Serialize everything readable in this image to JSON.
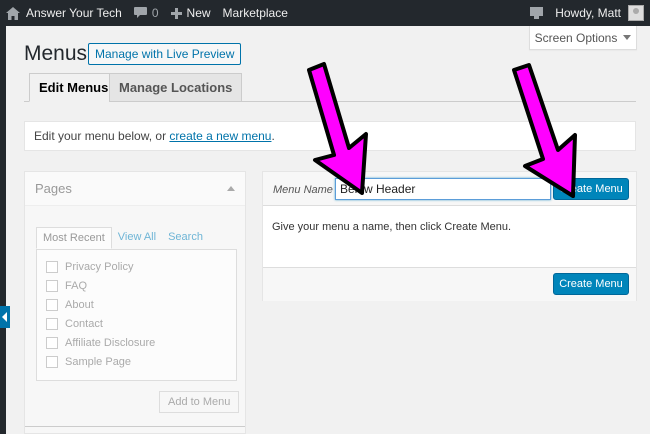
{
  "adminbar": {
    "site_name": "Answer Your Tech",
    "comments_count": "0",
    "new_label": "New",
    "marketplace_label": "Marketplace",
    "greeting": "Howdy, Matt"
  },
  "screen_options": {
    "label": "Screen Options"
  },
  "page": {
    "title": "Menus",
    "live_preview_label": "Manage with Live Preview"
  },
  "tabs": [
    {
      "label": "Edit Menus"
    },
    {
      "label": "Manage Locations"
    }
  ],
  "notice": {
    "prefix": "Edit your menu below, or ",
    "link": "create a new menu",
    "suffix": "."
  },
  "pages_panel": {
    "title": "Pages",
    "tabs": [
      {
        "label": "Most Recent"
      },
      {
        "label": "View All"
      },
      {
        "label": "Search"
      }
    ],
    "items": [
      {
        "label": "Privacy Policy"
      },
      {
        "label": "FAQ"
      },
      {
        "label": "About"
      },
      {
        "label": "Contact"
      },
      {
        "label": "Affiliate Disclosure"
      },
      {
        "label": "Sample Page"
      }
    ],
    "add_label": "Add to Menu"
  },
  "menu_editor": {
    "name_label": "Menu Name",
    "name_value": "Below Header",
    "create_label": "Create Menu",
    "instructions": "Give your menu a name, then click Create Menu."
  },
  "colors": {
    "adminbar_bg": "#23282d",
    "primary_button": "#0085ba",
    "link": "#0073aa",
    "annotation_arrow": "#ff00ff"
  },
  "icons": {
    "wp_logo": "house-icon",
    "comments": "speech-bubble-icon",
    "new": "plus-icon",
    "notifications": "monitor-icon",
    "avatar": "avatar",
    "screen_options_caret": "triangle-down-icon",
    "pages_toggle": "triangle-up-icon",
    "collapse": "arrow-left-icon"
  }
}
